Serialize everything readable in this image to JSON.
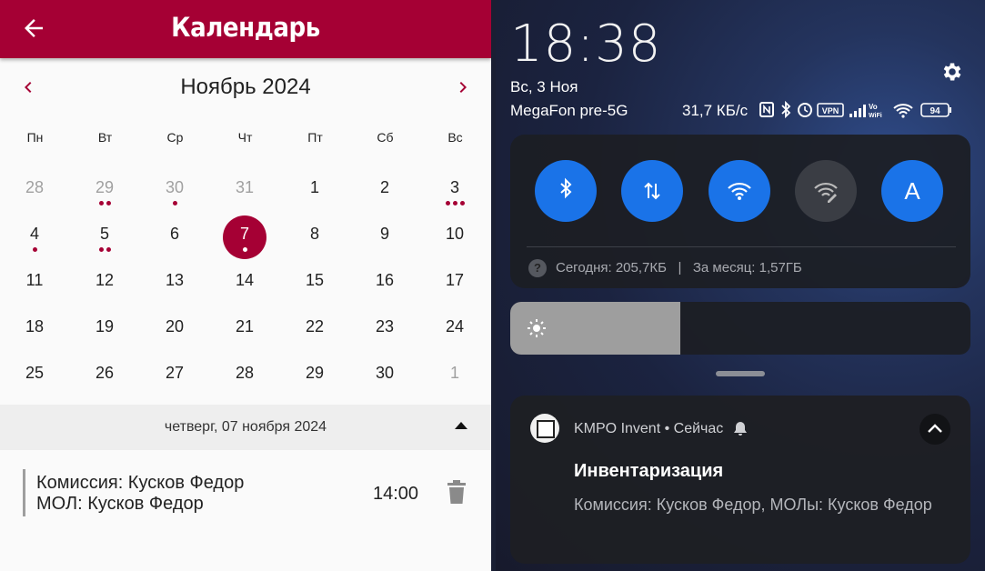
{
  "calendar": {
    "title": "Календарь",
    "month": "Ноябрь 2024",
    "weekdays": [
      "Пн",
      "Вт",
      "Ср",
      "Чт",
      "Пт",
      "Сб",
      "Вс"
    ],
    "weeks": [
      [
        {
          "d": "28",
          "other": true,
          "dots": 0
        },
        {
          "d": "29",
          "other": true,
          "dots": 2
        },
        {
          "d": "30",
          "other": true,
          "dots": 1
        },
        {
          "d": "31",
          "other": true,
          "dots": 0
        },
        {
          "d": "1",
          "dots": 0
        },
        {
          "d": "2",
          "dots": 0
        },
        {
          "d": "3",
          "dots": 3
        }
      ],
      [
        {
          "d": "4",
          "dots": 1
        },
        {
          "d": "5",
          "dots": 2
        },
        {
          "d": "6",
          "dots": 0
        },
        {
          "d": "7",
          "dots": 1,
          "selected": true
        },
        {
          "d": "8",
          "dots": 0
        },
        {
          "d": "9",
          "dots": 0
        },
        {
          "d": "10",
          "dots": 0
        }
      ],
      [
        {
          "d": "11",
          "dots": 0
        },
        {
          "d": "12",
          "dots": 0
        },
        {
          "d": "13",
          "dots": 0
        },
        {
          "d": "14",
          "dots": 0
        },
        {
          "d": "15",
          "dots": 0
        },
        {
          "d": "16",
          "dots": 0
        },
        {
          "d": "17",
          "dots": 0
        }
      ],
      [
        {
          "d": "18",
          "dots": 0
        },
        {
          "d": "19",
          "dots": 0
        },
        {
          "d": "20",
          "dots": 0
        },
        {
          "d": "21",
          "dots": 0
        },
        {
          "d": "22",
          "dots": 0
        },
        {
          "d": "23",
          "dots": 0
        },
        {
          "d": "24",
          "dots": 0
        }
      ],
      [
        {
          "d": "25",
          "dots": 0
        },
        {
          "d": "26",
          "dots": 0
        },
        {
          "d": "27",
          "dots": 0
        },
        {
          "d": "28",
          "dots": 0
        },
        {
          "d": "29",
          "dots": 0
        },
        {
          "d": "30",
          "dots": 0
        },
        {
          "d": "1",
          "other": true,
          "dots": 0
        }
      ]
    ],
    "selected_date": "четверг, 07 ноября 2024",
    "event": {
      "line1": "Комиссия: Кусков Федор",
      "line2": "МОЛ: Кусков Федор",
      "time": "14:00"
    },
    "accent": "#a50034"
  },
  "status": {
    "time": "18:38",
    "date": "Вс, 3 Ноя",
    "carrier": "MegaFon pre-5G",
    "speed": "31,7 КБ/с",
    "vpn": "VPN",
    "vowifi": "Vo WiFi",
    "battery": "94"
  },
  "quick_settings": {
    "tiles": [
      {
        "name": "bluetooth-tile",
        "icon": "bluetooth-icon",
        "on": true
      },
      {
        "name": "mobile-data-tile",
        "icon": "data-arrows-icon",
        "on": true
      },
      {
        "name": "wifi-tile",
        "icon": "wifi-icon",
        "on": true
      },
      {
        "name": "wifi-edit-tile",
        "icon": "wifi-edit-icon",
        "on": false
      },
      {
        "name": "auto-brightness-tile",
        "icon": "letter-a-icon",
        "on": true,
        "label": "A"
      }
    ],
    "data_help": "?",
    "data_usage": "Сегодня: 205,7КБ   |   За месяц: 1,57ГБ",
    "brightness_level": 0.37
  },
  "notification": {
    "app": "KMPO Invent • Сейчас",
    "title": "Инвентаризация",
    "body": "Комиссия: Кусков Федор, МОЛы: Кусков Федор"
  }
}
